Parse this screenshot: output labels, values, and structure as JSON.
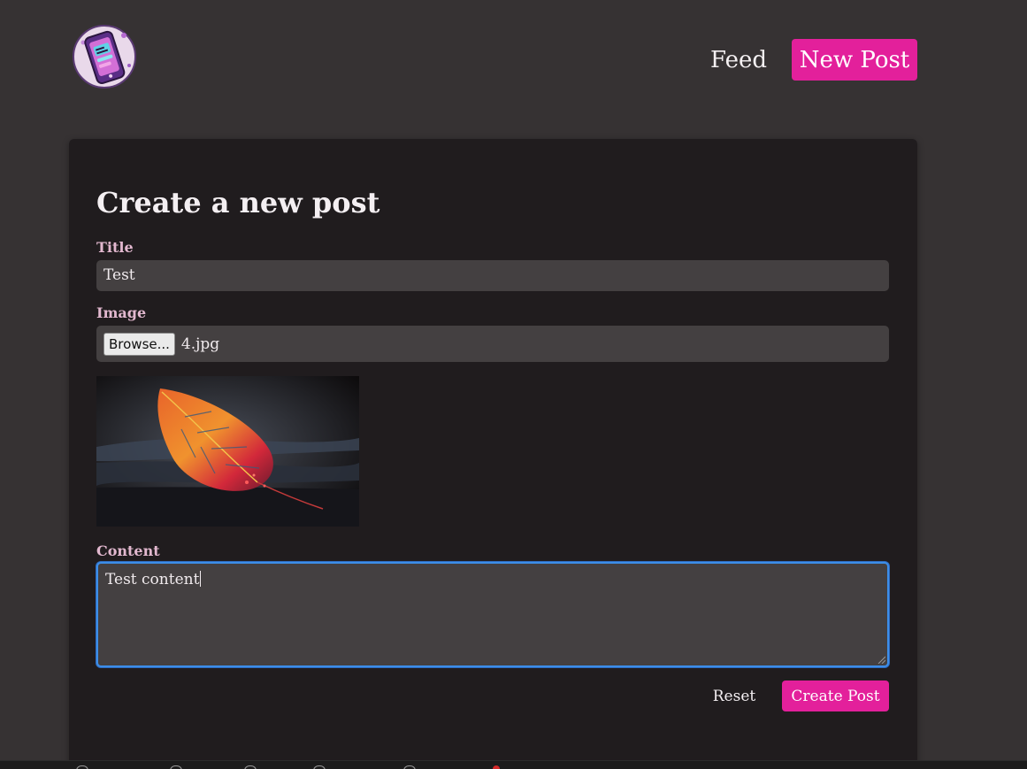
{
  "header": {
    "nav": {
      "feed_label": "Feed",
      "new_post_label": "New Post"
    }
  },
  "form": {
    "heading": "Create a new post",
    "title_label": "Title",
    "title_value": "Test",
    "image_label": "Image",
    "browse_label": "Browse...",
    "file_name": "4.jpg",
    "content_label": "Content",
    "content_value": "Test content",
    "reset_label": "Reset",
    "submit_label": "Create Post"
  },
  "colors": {
    "background": "#363233",
    "card": "#201c1e",
    "accent": "#e3209b",
    "input": "#444041",
    "label": "#e2b8cf",
    "focus": "#3d8ee8"
  }
}
